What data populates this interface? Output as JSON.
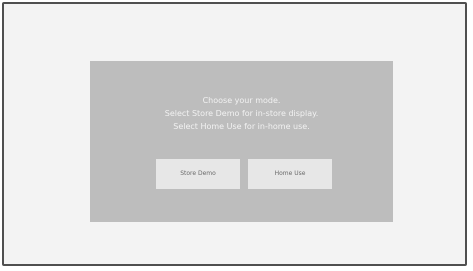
{
  "dialog": {
    "lines": [
      "Choose your mode.",
      "Select Store Demo for in-store display.",
      "Select Home Use for in-home use."
    ],
    "buttons": {
      "store_demo": "Store Demo",
      "home_use": "Home Use"
    }
  }
}
